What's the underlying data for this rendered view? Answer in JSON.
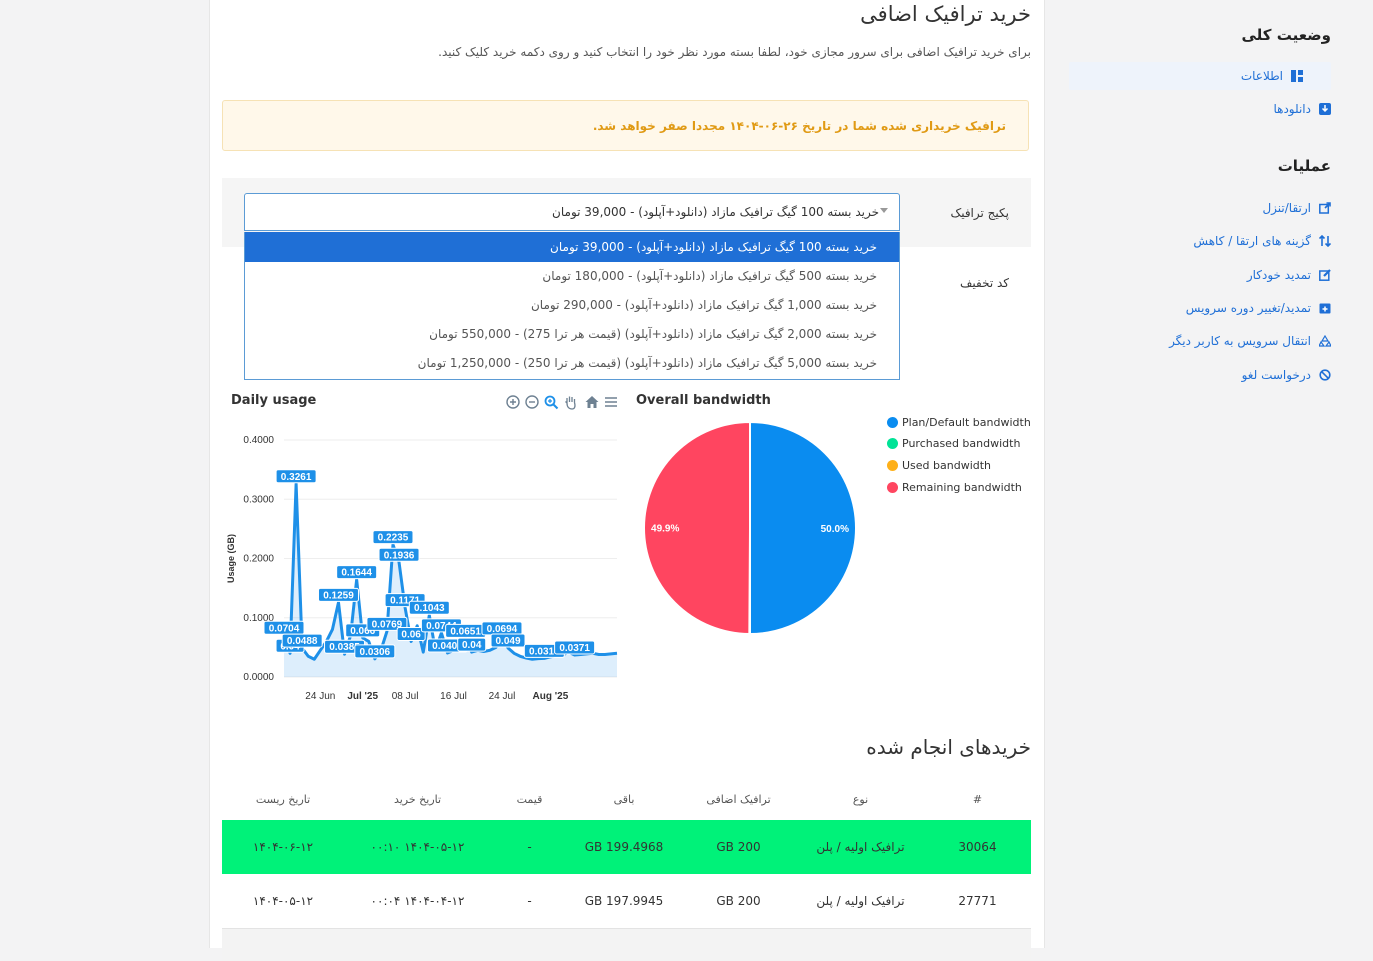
{
  "header": {
    "title": "خرید ترافیک اضافی",
    "description": "برای خرید ترافیک اضافی برای سرور مجازی خود، لطفا بسته مورد نظر خود را انتخاب کنید و روی دکمه خرید کلیک کنید."
  },
  "alert": {
    "text": "ترافیک خریداری شده شما در تاریخ ۲۶-۰۶-۱۴۰۴ مجددا صفر خواهد شد."
  },
  "form": {
    "package_label": "پکیج ترافیک",
    "discount_label": "کد تخفیف",
    "selected_package": "خرید بسته 100 گیگ ترافیک مازاد (دانلود+آپلود) - 39,000 تومان",
    "options": [
      "خرید بسته 100 گیگ ترافیک مازاد (دانلود+آپلود) - 39,000 تومان",
      "خرید بسته 500 گیگ ترافیک مازاد (دانلود+آپلود) - 180,000 تومان",
      "خرید بسته 1,000 گیگ ترافیک مازاد (دانلود+آپلود) - 290,000 تومان",
      "خرید بسته 2,000 گیگ ترافیک مازاد (دانلود+آپلود) (قیمت هر ترا 275) - 550,000 تومان",
      "خرید بسته 5,000 گیگ ترافیک مازاد (دانلود+آپلود) (قیمت هر ترا 250) - 1,250,000 تومان"
    ]
  },
  "sidebar": {
    "status_heading": "وضعیت کلی",
    "status_items": [
      {
        "label": "اطلاعات",
        "icon": "dashboard-icon"
      },
      {
        "label": "دانلودها",
        "icon": "download-icon"
      }
    ],
    "operations_heading": "عملیات",
    "operation_items": [
      {
        "label": "ارتقا/تنزل",
        "icon": "external-link-icon"
      },
      {
        "label": "گزینه های ارتقا / کاهش",
        "icon": "sort-arrows-icon"
      },
      {
        "label": "تمدید خودکار",
        "icon": "edit-icon"
      },
      {
        "label": "تمدید/تغییر دوره سرویس",
        "icon": "calendar-plus-icon"
      },
      {
        "label": "انتقال سرویس به کاربر دیگر",
        "icon": "recycle-icon"
      },
      {
        "label": "درخواست لغو",
        "icon": "ban-icon"
      }
    ]
  },
  "colors": {
    "accent": "#1f6fd6",
    "alert_text": "#e09a14",
    "highlight_row": "#00f279",
    "chart_line": "#1e90e8",
    "pie_blue": "#0a8cf0",
    "pie_red": "#ff4560",
    "pie_green": "#00e396",
    "pie_orange": "#feb019"
  },
  "chart_data": [
    {
      "type": "line",
      "title": "Daily usage",
      "xlabel": "",
      "ylabel": "Usage (GB)",
      "ylim": [
        0,
        0.4
      ],
      "yticks": [
        "0.0000",
        "0.1000",
        "0.2000",
        "0.3000",
        "0.4000"
      ],
      "xticks": [
        "24 Jun",
        "Jul '25",
        "08 Jul",
        "16 Jul",
        "24 Jul",
        "Aug '25"
      ],
      "x": [
        "2025-06-18",
        "2025-06-19",
        "2025-06-20",
        "2025-06-21",
        "2025-06-22",
        "2025-06-23",
        "2025-06-24",
        "2025-06-25",
        "2025-06-26",
        "2025-06-27",
        "2025-06-28",
        "2025-06-29",
        "2025-06-30",
        "2025-07-01",
        "2025-07-02",
        "2025-07-03",
        "2025-07-04",
        "2025-07-05",
        "2025-07-06",
        "2025-07-07",
        "2025-07-08",
        "2025-07-09",
        "2025-07-10",
        "2025-07-11",
        "2025-07-12",
        "2025-07-13",
        "2025-07-14",
        "2025-07-15",
        "2025-07-16",
        "2025-07-17",
        "2025-07-18",
        "2025-07-19",
        "2025-07-20",
        "2025-07-21",
        "2025-07-22",
        "2025-07-23",
        "2025-07-24",
        "2025-07-25",
        "2025-07-26",
        "2025-07-27",
        "2025-07-28",
        "2025-07-29",
        "2025-07-30",
        "2025-07-31",
        "2025-08-01",
        "2025-08-02",
        "2025-08-03",
        "2025-08-04",
        "2025-08-05",
        "2025-08-06",
        "2025-08-07",
        "2025-08-08",
        "2025-08-09",
        "2025-08-10",
        "2025-08-11",
        "2025-08-12"
      ],
      "series": [
        {
          "values": [
            0.0704,
            0.04,
            0.3261,
            0.0488,
            0.035,
            0.03,
            0.045,
            0.06,
            0.0803,
            0.1259,
            0.0385,
            0.07,
            0.1644,
            0.066,
            0.06,
            0.0306,
            0.045,
            0.0769,
            0.2235,
            0.1936,
            0.1171,
            0.06,
            0.0864,
            0.042,
            0.1043,
            0.045,
            0.0744,
            0.0405,
            0.045,
            0.05,
            0.0651,
            0.042,
            0.045,
            0.043,
            0.045,
            0.05,
            0.0694,
            0.049,
            0.04,
            0.035,
            0.032,
            0.03,
            0.031,
            0.0314,
            0.034,
            0.036,
            0.037,
            0.042,
            0.0371,
            0.038,
            0.039,
            0.04,
            0.038,
            0.038,
            0.039,
            0.04
          ],
          "labels": [
            "0.0704",
            "0.04",
            "0.3261",
            "0.0488",
            "",
            "",
            "",
            "",
            "",
            "0.1259",
            "0.0385",
            "",
            "0.1644",
            "0.066",
            "",
            "0.0306",
            "",
            "0.0769",
            "0.2235",
            "0.1936",
            "0.1171",
            "0.06",
            "",
            "",
            "0.1043",
            "",
            "0.0744",
            "0.0405",
            "",
            "",
            "0.0651",
            "0.04",
            "",
            "",
            "",
            "",
            "0.0694",
            "0.049",
            "",
            "",
            "",
            "",
            "",
            "0.0314",
            "",
            "",
            "",
            "",
            "0.0371",
            "",
            "",
            "",
            "",
            "",
            "",
            ""
          ]
        }
      ]
    },
    {
      "type": "pie",
      "title": "Overall bandwidth",
      "legend": [
        "Plan/Default bandwidth",
        "Purchased bandwidth",
        "Used bandwidth",
        "Remaining bandwidth"
      ],
      "values": [
        50.0,
        0.05,
        0.05,
        49.9
      ],
      "labels": [
        "50.0%",
        "",
        "",
        "49.9%"
      ]
    }
  ],
  "purchases": {
    "title": "خریدهای انجام شده",
    "columns": [
      "#",
      "نوع",
      "ترافیک اضافی",
      "باقی",
      "قیمت",
      "تاریخ خرید",
      "تاریخ ریست"
    ],
    "rows": [
      [
        "30064",
        "ترافیک اولیه / پلن",
        "200 GB",
        "199.4968 GB",
        "-",
        "۱۴۰۴-۰۵-۱۲ ۰۰:۱۰",
        "۱۴۰۴-۰۶-۱۲"
      ],
      [
        "27771",
        "ترافیک اولیه / پلن",
        "200 GB",
        "197.9945 GB",
        "-",
        "۱۴۰۴-۰۴-۱۲ ۰۰:۰۴",
        "۱۴۰۴-۰۵-۱۲"
      ]
    ]
  }
}
